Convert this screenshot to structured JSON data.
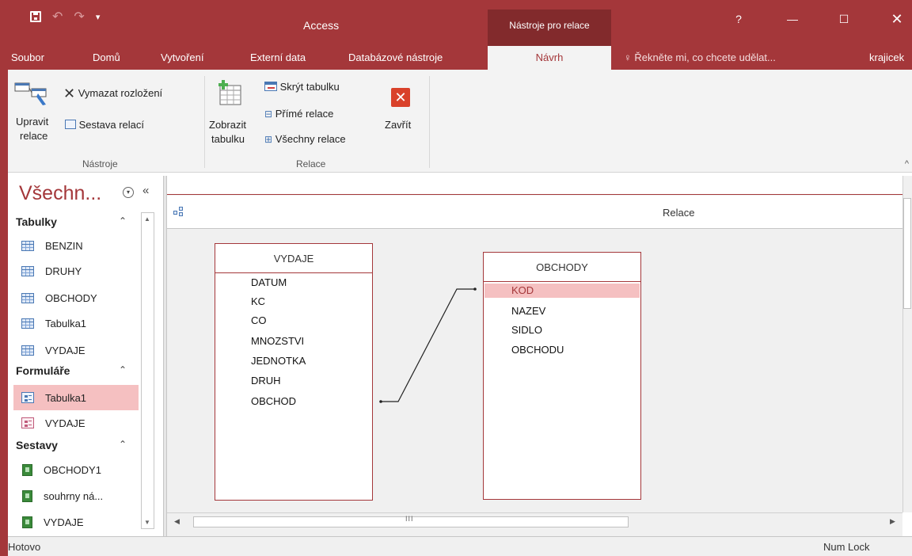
{
  "window": {
    "app_title": "Access",
    "context_tab_title": "Nástroje pro relace",
    "help_glyph": "?",
    "minimize_glyph": "—",
    "maximize_glyph": "☐",
    "close_glyph": "✕"
  },
  "quick_access": {
    "save_icon": "save-icon",
    "undo_glyph": "↶",
    "redo_glyph": "↷",
    "customize_glyph": "▾"
  },
  "tabs": [
    {
      "label": "Soubor"
    },
    {
      "label": "Domů"
    },
    {
      "label": "Vytvoření"
    },
    {
      "label": "Externí data"
    },
    {
      "label": "Databázové nástroje"
    },
    {
      "label": "Návrh",
      "active": true
    }
  ],
  "tell_me": {
    "placeholder": "Řekněte mi, co chcete udělat..."
  },
  "user_name": "krajicek",
  "ribbon": {
    "groups": {
      "nastroje": {
        "label": "Nástroje",
        "edit_relationships_line1": "Upravit",
        "edit_relationships_line2": "relace",
        "clear_layout": "Vymazat rozložení",
        "relationship_report": "Sestava relací"
      },
      "relace": {
        "label": "Relace",
        "show_table_line1": "Zobrazit",
        "show_table_line2": "tabulku",
        "hide_table": "Skrýt tabulku",
        "direct_relationships": "Přímé relace",
        "all_relationships": "Všechny relace",
        "close": "Zavřít"
      }
    },
    "collapse_glyph": "^"
  },
  "nav_pane": {
    "title": "Všechn...",
    "collapse_glyph": "«",
    "menu_glyph": "▾",
    "groups": [
      {
        "label": "Tabulky",
        "chevron": "≈",
        "items": [
          "BENZIN",
          "DRUHY",
          "OBCHODY",
          "Tabulka1",
          "VYDAJE"
        ]
      },
      {
        "label": "Formuláře",
        "chevron": "≈",
        "items": [
          "Tabulka1",
          "VYDAJE"
        ]
      },
      {
        "label": "Sestavy",
        "chevron": "≈",
        "items": [
          "OBCHODY1",
          "souhrny ná...",
          "VYDAJE"
        ]
      }
    ],
    "selected_item": "Tabulka1"
  },
  "document": {
    "tab_title": "Relace"
  },
  "tables": {
    "vydaje": {
      "title": "VYDAJE",
      "fields": [
        "DATUM",
        "KC",
        "CO",
        "MNOZSTVI",
        "JEDNOTKA",
        "DRUH",
        "OBCHOD"
      ]
    },
    "obchody": {
      "title": "OBCHODY",
      "fields": [
        "KOD",
        "NAZEV",
        "SIDLO",
        "OBCHODU"
      ],
      "selected_field": "KOD"
    }
  },
  "scroll": {
    "grip": "III",
    "left_arrow": "◀",
    "right_arrow": "▶",
    "up_arrow": "▲",
    "down_arrow": "▼"
  },
  "status": {
    "left": "Hotovo",
    "right": "Num Lock"
  },
  "colors": {
    "accent": "#a4373a",
    "selection": "#f5c0c1"
  }
}
